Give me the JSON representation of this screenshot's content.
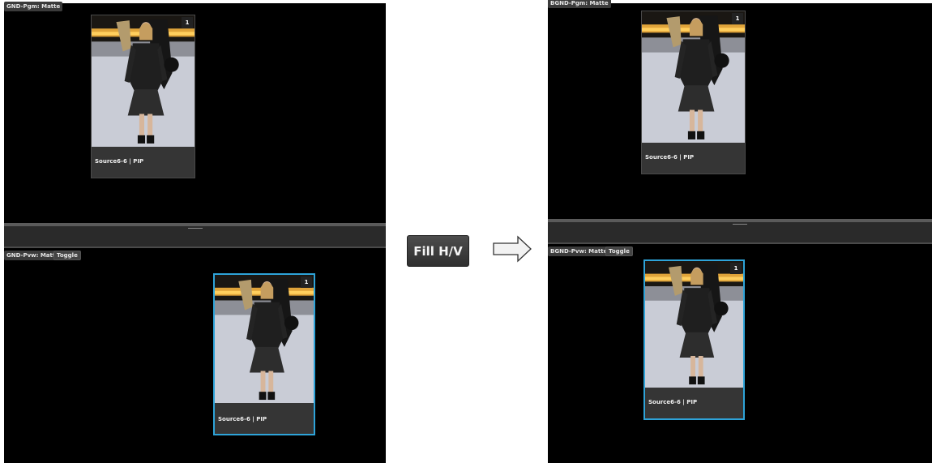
{
  "before": {
    "pgm_tag": "GND-Pgm: Matte",
    "pvw_tag": "GND-Pvw: Matte",
    "toggle_label": "Toggle",
    "pgm_pip": {
      "label": "Source6-6 | PIP",
      "layer": "1"
    },
    "pvw_pip": {
      "label": "Source6-6 | PIP",
      "layer": "1"
    }
  },
  "action": {
    "button_label": "Fill H/V",
    "arrow": "right-arrow-icon"
  },
  "after": {
    "pgm_tag": "BGND-Pgm: Matte",
    "pvw_tag": "BGND-Pvw: Matte",
    "toggle_label": "Toggle",
    "pgm_pip": {
      "label": "Source6-6 | PIP",
      "layer": "1"
    },
    "pvw_pip": {
      "label": "Source6-6 | PIP",
      "layer": "1"
    }
  },
  "colors": {
    "selection": "#2ea3d8",
    "panel_bg": "#000000",
    "divider": "#2a2a2a"
  }
}
